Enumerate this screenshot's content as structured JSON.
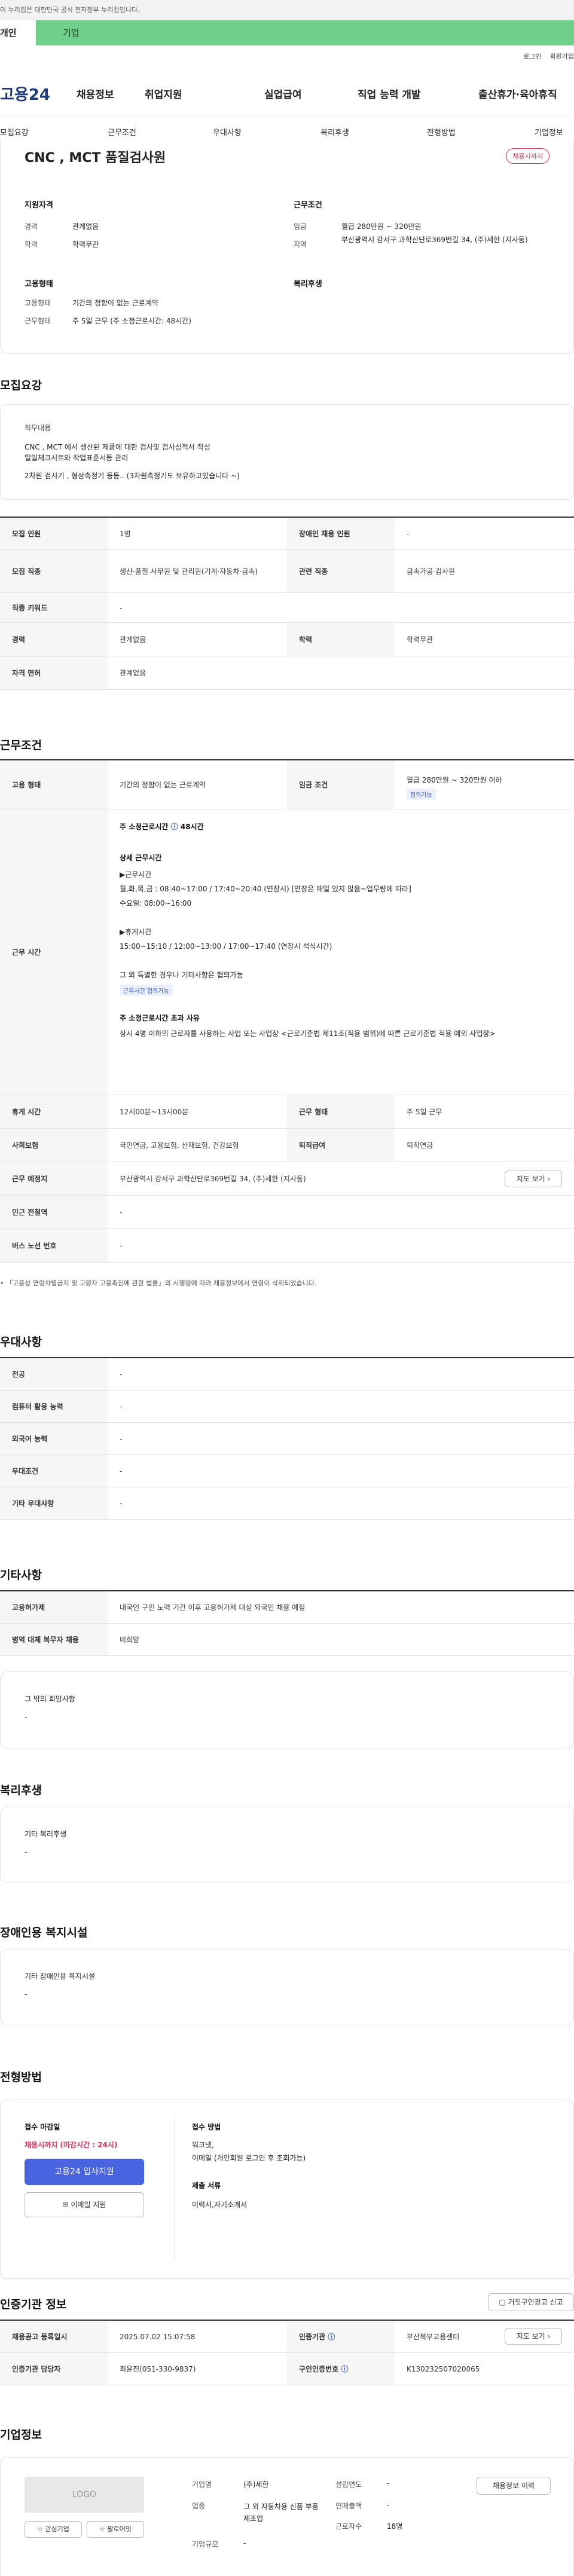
{
  "gov_notice": "이 누리집은 대한민국 공식 전자정부 누리집입니다.",
  "top_tabs": {
    "personal": "개인",
    "company": "기업"
  },
  "util": {
    "login": "로그인",
    "signup": "회원가입"
  },
  "logo": "고용24",
  "gnb": [
    "채용정보",
    "취업지원",
    "실업급여",
    "직업 능력 개발",
    "출산휴가·육아휴직"
  ],
  "subnav": [
    "모집요강",
    "근무조건",
    "우대사항",
    "복리후생",
    "전형방법",
    "기업정보"
  ],
  "summary": {
    "title": "CNC , MCT 품질검사원",
    "status_badge": "채용시까지",
    "qual_title": "지원자격",
    "career_label": "경력",
    "career": "관계없음",
    "edu_label": "학력",
    "edu": "학력무관",
    "employ_title": "고용형태",
    "emptype_label": "고용형태",
    "emptype": "기간의 정함이 없는 근로계약",
    "worktype_label": "근무형태",
    "worktype": "주 5일 근무 (주 소정근로시간: 48시간)",
    "cond_title": "근무조건",
    "wage_label": "임금",
    "wage": "월급 280만원 ~ 320만원",
    "loc_label": "지역",
    "loc": "부산광역시 강서구 과학산단로369번길 34, (주)세한 (지사동)",
    "welfare_title": "복리후생"
  },
  "recruit": {
    "title": "모집요강",
    "duty_title": "직무내용",
    "duty_lines": [
      "CNC , MCT 에서 생산된 제품에 대한 검사및 검사성적서 작성",
      "일일체크시트와 작업표준서등 관리",
      "2차원 검사기 , 형상측정기 등등..     (3차원측정기도 보유하고있습니다 ~)"
    ],
    "rows": [
      {
        "l1": "모집 인원",
        "v1": "1명",
        "l2": "장애인 채용 인원",
        "v2": "-"
      },
      {
        "l1": "모집 직종",
        "v1": "생산·품질 사무원 및 관리원(기계·자동차·금속)",
        "l2": "관련 직종",
        "v2": "금속가공 검사원"
      },
      {
        "l1": "직종 키워드",
        "v1": "-"
      },
      {
        "l1": "경력",
        "v1": "관계없음",
        "l2": "학력",
        "v2": "학력무관"
      },
      {
        "l1": "자격 면허",
        "v1": "관계없음"
      }
    ]
  },
  "conditions": {
    "title": "근무조건",
    "emptype_label": "고용 형태",
    "emptype": "기간의 정함이 없는 근로계약",
    "wage_label": "임금 조건",
    "wage": "월급 280만원 ~ 320만원 이하",
    "wage_chip": "협의가능",
    "hours_label": "근무 시간",
    "hours_head": "주 소정근로시간",
    "hours_value": "48시간",
    "detail_title": "상세 근무시간",
    "detail_lines": [
      "▶근무시간",
      "월,화,목,금 : 08:40~17:00 / 17:40~20:40 (연장시) [연장은 매일 있지 않음~업무량에 따라]",
      "수요일: 08:00~16:00",
      "",
      "▶휴게시간",
      "15:00~15:10 / 12:00~13:00 / 17:00~17:40 (연장시 석식시간)",
      "",
      "그 외 특별한 경우나 기타사항은 협의가능"
    ],
    "hours_chip": "근무시간 협의가능",
    "over_title": "주 소정근로시간 초과 사유",
    "over_text": "상시 4명 이하의 근로자를 사용하는 사업 또는 사업장 <근로기준법 제11조(적용 범위)에 따른 근로기준법 적용 예외 사업장>",
    "rows": [
      {
        "l1": "휴게 시간",
        "v1": "12시00분~13시00분",
        "l2": "근무 형태",
        "v2": "주 5일 근무"
      },
      {
        "l1": "사회보험",
        "v1": "국민연금, 고용보험, 산재보험, 건강보험",
        "l2": "퇴직급여",
        "v2": "퇴직연금"
      },
      {
        "l1": "근무 예정지",
        "v1": "부산광역시 강서구 과학산단로369번길 34, (주)세한 (지사동)",
        "btn": "지도 보기"
      },
      {
        "l1": "인근 전철역",
        "v1": "-"
      },
      {
        "l1": "버스 노선 번호",
        "v1": "-"
      }
    ],
    "footnote": "「고용상 연령차별금지 및 고령자 고용촉진에 관한 법률」의 시행령에 따라 채용정보에서 연령이 삭제되었습니다."
  },
  "preference": {
    "title": "우대사항",
    "rows": [
      {
        "l": "전공",
        "v": "-"
      },
      {
        "l": "컴퓨터 활용 능력",
        "v": "-"
      },
      {
        "l": "외국어 능력",
        "v": "-"
      },
      {
        "l": "우대조건",
        "v": "-"
      },
      {
        "l": "기타 우대사항",
        "v": "-"
      }
    ]
  },
  "other": {
    "title": "기타사항",
    "rows": [
      {
        "l": "고용허가제",
        "v": "내국인 구인 노력 기간 이후 고용허가제 대상 외국인 채용 예정"
      },
      {
        "l": "병역 대체 복무자 채용",
        "v": "비희망"
      }
    ],
    "box_title": "그 밖의 희망사항",
    "box_value": "-"
  },
  "welfare": {
    "title": "복리후생",
    "box_title": "기타 복리후생",
    "box_value": "-"
  },
  "disability": {
    "title": "장애인용 복지시설",
    "box_title": "기타 장애인용 복지시설",
    "box_value": "-"
  },
  "selection": {
    "title": "전형방법",
    "deadline_title": "접수 마감일",
    "deadline": "채용시까지 (마감시간 : 24시)",
    "apply_btn": "고용24 입사지원",
    "email_btn": "이메일 지원",
    "method_title": "접수 방법",
    "method": "워크넷,",
    "method2": "이메일 (개인회원 로그인 후 조회가능)",
    "docs_title": "제출 서류",
    "docs": "이력서,자기소개서"
  },
  "agency": {
    "title": "인증기관 정보",
    "report_btn": "거짓구인광고 신고",
    "rows": [
      {
        "l1": "채용공고 등록일시",
        "v1": "2025.07.02 15:07:58",
        "l2": "인증기관",
        "v2": "부산북부고용센터",
        "btn": "지도 보기"
      },
      {
        "l1": "인증기관 담당자",
        "v1": "최윤진(051-330-9837)",
        "l2": "구인인증번호",
        "v2": "K130232507020065"
      }
    ]
  },
  "company": {
    "title": "기업정보",
    "logo": "LOGO",
    "fav_btn": "관심기업",
    "follow_btn": "팔로어잇",
    "name_l": "기업명",
    "name": "(주)세한",
    "industry_l": "업종",
    "industry": "그 외 자동차용 신품 부품 제조업",
    "size_l": "기업규모",
    "size": "-",
    "est_l": "설립연도",
    "est": "-",
    "sales_l": "연매출액",
    "sales": "-",
    "staff_l": "근로자수",
    "staff": "18명",
    "more_btn": "채용정보 이력"
  }
}
